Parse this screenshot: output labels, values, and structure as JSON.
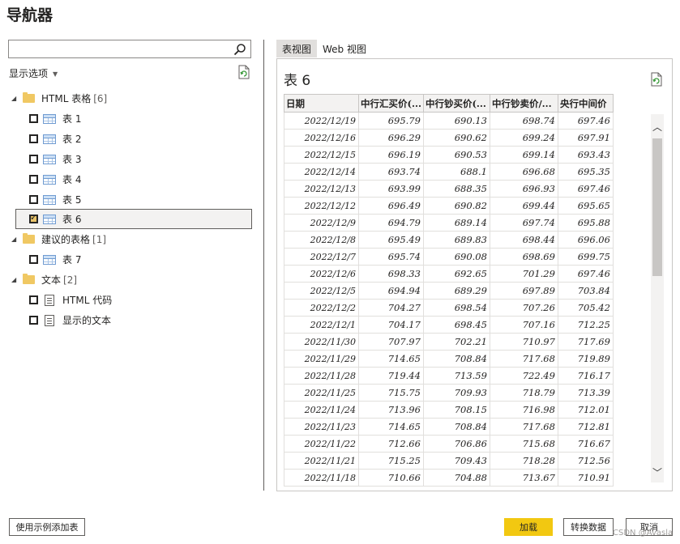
{
  "window": {
    "title": "导航器"
  },
  "search": {
    "placeholder": ""
  },
  "display_options": {
    "label": "显示选项"
  },
  "tree": [
    {
      "type": "group",
      "label": "HTML 表格",
      "count": "[6]"
    },
    {
      "type": "table",
      "label": "表 1",
      "checked": false
    },
    {
      "type": "table",
      "label": "表 2",
      "checked": false
    },
    {
      "type": "table",
      "label": "表 3",
      "checked": false
    },
    {
      "type": "table",
      "label": "表 4",
      "checked": false
    },
    {
      "type": "table",
      "label": "表 5",
      "checked": false
    },
    {
      "type": "table",
      "label": "表 6",
      "checked": true
    },
    {
      "type": "group",
      "label": "建议的表格",
      "count": "[1]"
    },
    {
      "type": "table",
      "label": "表 7",
      "checked": false
    },
    {
      "type": "group",
      "label": "文本",
      "count": "[2]"
    },
    {
      "type": "doc",
      "label": "HTML 代码",
      "checked": false
    },
    {
      "type": "doc",
      "label": "显示的文本",
      "checked": false
    }
  ],
  "tabs": [
    {
      "label": "表视图",
      "active": true
    },
    {
      "label": "Web 视图",
      "active": false
    }
  ],
  "preview": {
    "title": "表 6",
    "columns": [
      "日期",
      "中行汇买价(...",
      "中行钞买价(...",
      "中行钞卖价/...",
      "央行中间价"
    ],
    "rows": [
      [
        "2022/12/19",
        "695.79",
        "690.13",
        "698.74",
        "697.46"
      ],
      [
        "2022/12/16",
        "696.29",
        "690.62",
        "699.24",
        "697.91"
      ],
      [
        "2022/12/15",
        "696.19",
        "690.53",
        "699.14",
        "693.43"
      ],
      [
        "2022/12/14",
        "693.74",
        "688.1",
        "696.68",
        "695.35"
      ],
      [
        "2022/12/13",
        "693.99",
        "688.35",
        "696.93",
        "697.46"
      ],
      [
        "2022/12/12",
        "696.49",
        "690.82",
        "699.44",
        "695.65"
      ],
      [
        "2022/12/9",
        "694.79",
        "689.14",
        "697.74",
        "695.88"
      ],
      [
        "2022/12/8",
        "695.49",
        "689.83",
        "698.44",
        "696.06"
      ],
      [
        "2022/12/7",
        "695.74",
        "690.08",
        "698.69",
        "699.75"
      ],
      [
        "2022/12/6",
        "698.33",
        "692.65",
        "701.29",
        "697.46"
      ],
      [
        "2022/12/5",
        "694.94",
        "689.29",
        "697.89",
        "703.84"
      ],
      [
        "2022/12/2",
        "704.27",
        "698.54",
        "707.26",
        "705.42"
      ],
      [
        "2022/12/1",
        "704.17",
        "698.45",
        "707.16",
        "712.25"
      ],
      [
        "2022/11/30",
        "707.97",
        "702.21",
        "710.97",
        "717.69"
      ],
      [
        "2022/11/29",
        "714.65",
        "708.84",
        "717.68",
        "719.89"
      ],
      [
        "2022/11/28",
        "719.44",
        "713.59",
        "722.49",
        "716.17"
      ],
      [
        "2022/11/25",
        "715.75",
        "709.93",
        "718.79",
        "713.39"
      ],
      [
        "2022/11/24",
        "713.96",
        "708.15",
        "716.98",
        "712.01"
      ],
      [
        "2022/11/23",
        "714.65",
        "708.84",
        "717.68",
        "712.81"
      ],
      [
        "2022/11/22",
        "712.66",
        "706.86",
        "715.68",
        "716.67"
      ],
      [
        "2022/11/21",
        "715.25",
        "709.43",
        "718.28",
        "712.56"
      ],
      [
        "2022/11/18",
        "710.66",
        "704.88",
        "713.67",
        "710.91"
      ]
    ]
  },
  "buttons": {
    "add_from_examples": "使用示例添加表",
    "load": "加载",
    "transform": "转换数据",
    "cancel": "取消"
  },
  "watermark": "CSDN @Avasla",
  "colors": {
    "primary": "#f2c811",
    "folder": "#f0c863"
  }
}
